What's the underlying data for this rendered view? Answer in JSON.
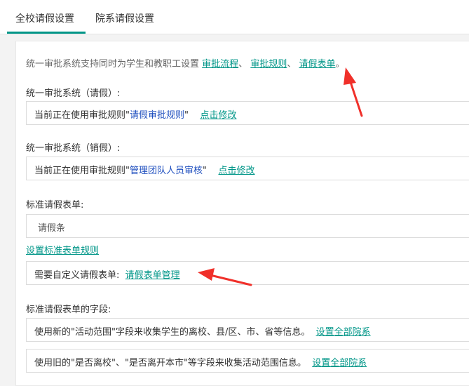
{
  "tabs": [
    {
      "label": "全校请假设置",
      "active": true
    },
    {
      "label": "院系请假设置",
      "active": false
    }
  ],
  "intro": {
    "text": "统一审批系统支持同时为学生和教职工设置 ",
    "links": [
      "审批流程",
      "审批规则",
      "请假表单"
    ],
    "sep": "、",
    "end": "。"
  },
  "leave_section": {
    "title": "统一审批系统（请假）:",
    "prefix": "当前正在使用审批规则\"",
    "rule": "请假审批规则",
    "suffix": "\"",
    "action": "点击修改"
  },
  "cancel_section": {
    "title": "统一审批系统（销假）:",
    "prefix": "当前正在使用审批规则\"",
    "rule": "管理团队人员审核",
    "suffix": "\"",
    "action": "点击修改"
  },
  "standard_form": {
    "title": "标准请假表单:",
    "selected": "请假条",
    "rules_link": "设置标准表单规则",
    "custom_text": "需要自定义请假表单:",
    "custom_link": "请假表单管理"
  },
  "fields_section": {
    "title": "标准请假表单的字段:",
    "new_text": "使用新的\"活动范围\"字段来收集学生的离校、县/区、市、省等信息。",
    "new_link": "设置全部院系",
    "old_text": "使用旧的\"是否离校\"、\"是否离开本市\"等字段来收集活动范围信息。",
    "old_link": "设置全部院系"
  },
  "colors": {
    "accent": "#009688",
    "rule_name": "#1f4fbf",
    "arrow": "#f0302a"
  }
}
